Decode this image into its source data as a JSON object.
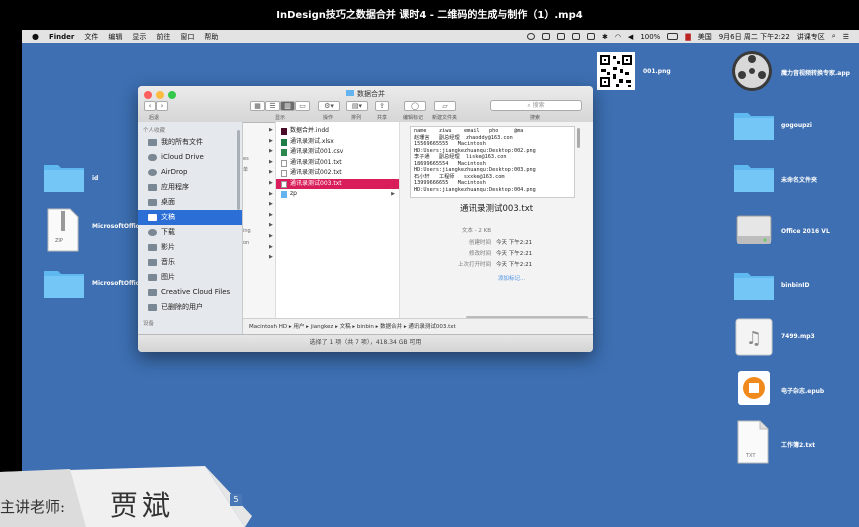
{
  "video_title": "InDesign技巧之数据合并 课时4 - 二维码的生成与制作（1）.mp4",
  "menubar": {
    "apple": "",
    "app": "Finder",
    "items": [
      "文件",
      "编辑",
      "显示",
      "前往",
      "窗口",
      "帮助"
    ],
    "battery": "100%",
    "input_method": "美国",
    "clock": "9月6日 周二 下午2:22",
    "user": "讲课专区"
  },
  "desktop": {
    "left_icons": [
      {
        "label": "id"
      },
      {
        "label": "MicrosoftOffice.zip"
      },
      {
        "label": "MicrosoftOffice"
      }
    ],
    "zip_badge": "ZIP",
    "qr_label": "001.png",
    "right_icons": [
      {
        "label": "魔力音视频转换专家.app"
      },
      {
        "label": "gogoupzi"
      },
      {
        "label": "未命名文件夹"
      },
      {
        "label": "Office 2016 VL"
      },
      {
        "label": "binbinID"
      },
      {
        "label": "7499.mp3"
      },
      {
        "label": "电子杂志.epub"
      },
      {
        "label": "工作簿2.txt"
      }
    ],
    "txt_badge": "TXT"
  },
  "finder": {
    "title": "数据合并",
    "toolbar_labels": {
      "back": "后退",
      "view": "显示",
      "action": "操作",
      "arrange": "排列",
      "share": "共享",
      "tags": "编辑标记",
      "new_folder": "新建文件夹",
      "search": "搜索"
    },
    "search_placeholder": "搜索",
    "sidebar": {
      "favorites_header": "个人收藏",
      "items": [
        {
          "label": "我的所有文件",
          "selected": false
        },
        {
          "label": "iCloud Drive",
          "selected": false
        },
        {
          "label": "AirDrop",
          "selected": false
        },
        {
          "label": "应用程序",
          "selected": false
        },
        {
          "label": "桌面",
          "selected": false
        },
        {
          "label": "文稿",
          "selected": true
        },
        {
          "label": "下载",
          "selected": false
        },
        {
          "label": "影片",
          "selected": false
        },
        {
          "label": "音乐",
          "selected": false
        },
        {
          "label": "图片",
          "selected": false
        },
        {
          "label": "Creative Cloud Files",
          "selected": false
        },
        {
          "label": "已删除的用户",
          "selected": false
        }
      ],
      "devices_header": "设备"
    },
    "col1_snippets": [
      "es",
      "单",
      "ing",
      "on"
    ],
    "files": [
      {
        "name": "数据合并.indd",
        "selected": false,
        "folder": false
      },
      {
        "name": "通讯录测试.xlsx",
        "selected": false,
        "folder": false
      },
      {
        "name": "通讯录测试001.csv",
        "selected": false,
        "folder": false
      },
      {
        "name": "通讯录测试001.txt",
        "selected": false,
        "folder": false
      },
      {
        "name": "通讯录测试002.txt",
        "selected": false,
        "folder": false
      },
      {
        "name": "通讯录测试003.txt",
        "selected": true,
        "folder": false
      },
      {
        "name": "zp",
        "selected": false,
        "folder": true
      }
    ],
    "preview": {
      "thumb_lines": [
        "name    ziwu    email   pho     @ma",
        "赵珊言   副总经理  zhaoddy@163.con",
        "15569665555   Macintosh",
        "HD:Users:jiangkezhuanqu:Desktop:002.png",
        "李子通   副总经理  liske@163.con",
        "18699665554   Macintosh",
        "HD:Users:jiangkezhuanqu:Desktop:003.png",
        "石小轩   工程师   sxxke@163.com",
        "13999666655   Macintosh",
        "HD:Users:jiangkezhuanqu:Desktop:004.png"
      ],
      "filename": "通讯录测试003.txt",
      "meta": [
        {
          "k": "文本 - 2 KB",
          "v": ""
        },
        {
          "k": "创建时间",
          "v": "今天 下午2:21"
        },
        {
          "k": "修改时间",
          "v": "今天 下午2:21"
        },
        {
          "k": "上次打开时间",
          "v": "今天 下午2:21"
        }
      ],
      "add_tags": "添加标记..."
    },
    "path": "Macintosh HD ▸ 用户 ▸ jiangkez ▸ 文稿 ▸ binbin ▸ 数据合并 ▸ 通讯录测试003.txt",
    "status": "选择了 1 项（共 7 项），418.34 GB 可用"
  },
  "lower_third": {
    "role": "主讲老师:",
    "name": "贾斌",
    "badge": "5"
  },
  "colors": {
    "desktop": "#3d6fb2",
    "selection": "#d91d5a",
    "sidebar_sel": "#2b6fd6",
    "folder": "#5fb8f0"
  }
}
